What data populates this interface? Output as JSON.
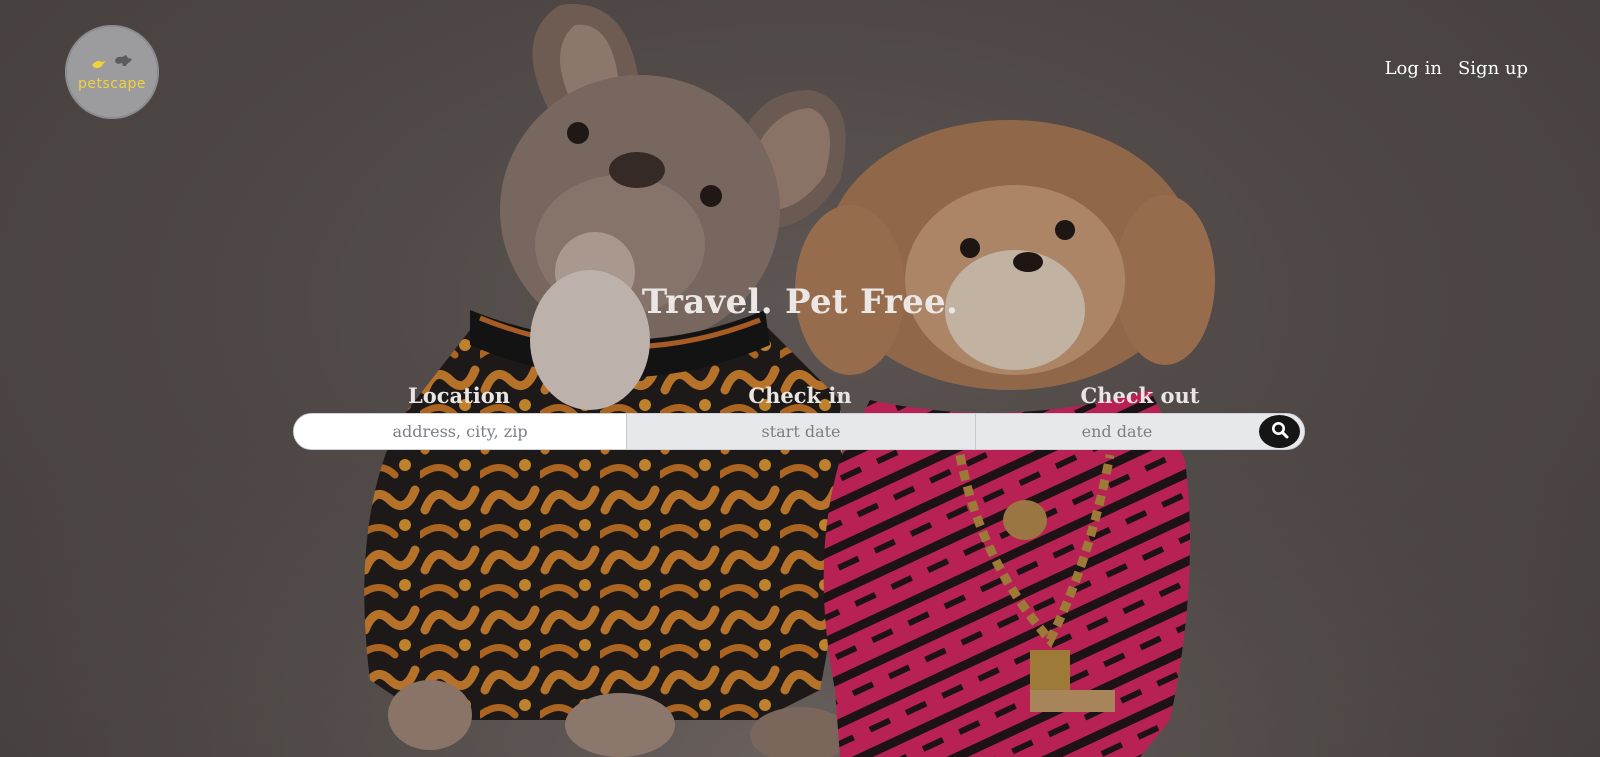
{
  "brand": {
    "name": "petscape",
    "logo_icons": [
      "bird-icon",
      "dog-icon"
    ],
    "accent": "#f2d23b"
  },
  "nav": {
    "login_label": "Log in",
    "signup_label": "Sign up"
  },
  "hero": {
    "title": "Travel. Pet Free."
  },
  "search": {
    "location_label": "Location",
    "location_placeholder": "address, city, zip",
    "checkin_label": "Check in",
    "checkin_placeholder": "start date",
    "checkout_label": "Check out",
    "checkout_placeholder": "end date",
    "button_icon": "search-icon"
  }
}
